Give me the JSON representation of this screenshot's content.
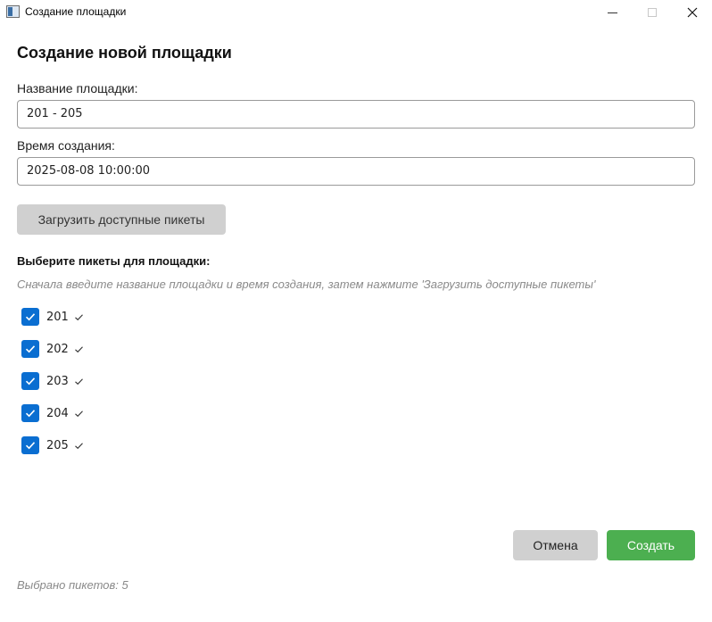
{
  "window": {
    "title": "Создание площадки"
  },
  "form": {
    "heading": "Создание новой площадки",
    "name_label": "Название площадки:",
    "name_value": "201 - 205",
    "time_label": "Время создания:",
    "time_value": "2025-08-08 10:00:00",
    "load_button_label": "Загрузить доступные пикеты"
  },
  "pickets": {
    "heading": "Выберите пикеты для площадки:",
    "hint": "Сначала введите название площадки и время создания, затем нажмите 'Загрузить доступные пикеты'",
    "items": [
      {
        "label": "201",
        "checked": true
      },
      {
        "label": "202",
        "checked": true
      },
      {
        "label": "203",
        "checked": true
      },
      {
        "label": "204",
        "checked": true
      },
      {
        "label": "205",
        "checked": true
      }
    ]
  },
  "actions": {
    "cancel_label": "Отмена",
    "create_label": "Создать"
  },
  "status": {
    "selected_text": "Выбрано пикетов: 5"
  },
  "colors": {
    "accent": "#0a6ed1",
    "create_button": "#4caf50",
    "secondary_button": "#d0d0d0"
  }
}
